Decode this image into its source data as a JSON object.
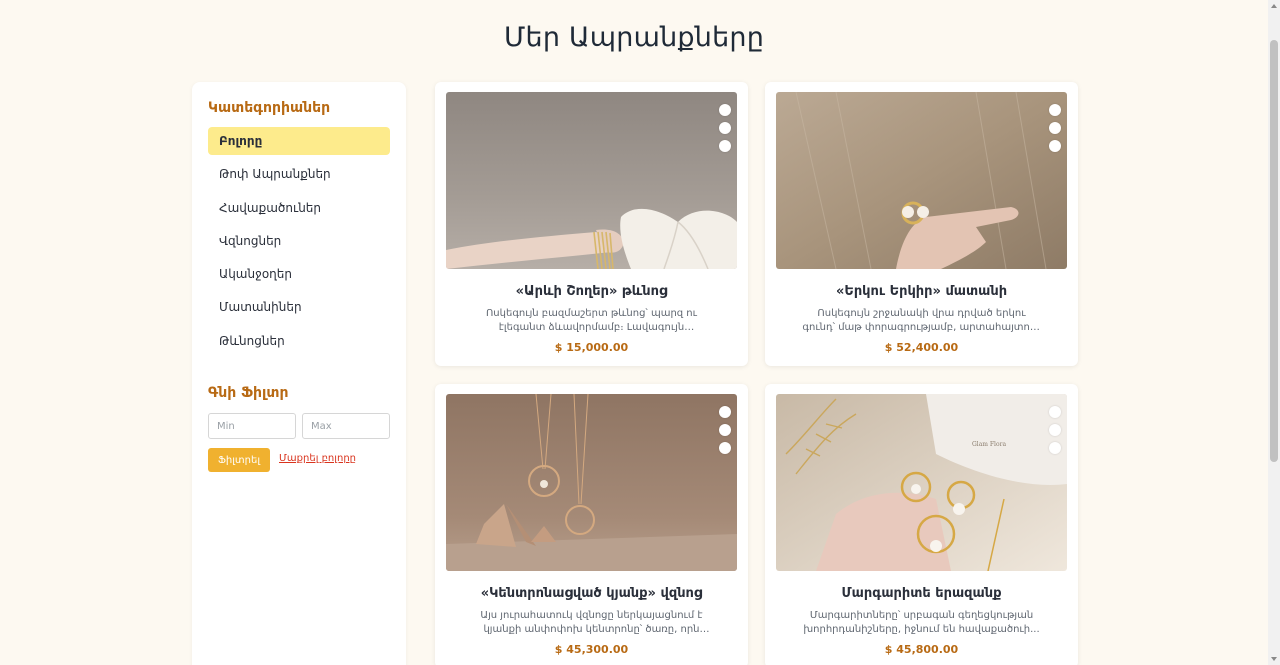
{
  "page": {
    "title": "Մեր Ապրանքները"
  },
  "sidebar": {
    "categories_title": "Կատեգորիաներ",
    "categories": [
      {
        "label": "Բոլորը",
        "active": true
      },
      {
        "label": "Թոփ Ապրանքներ",
        "active": false
      },
      {
        "label": "Հավաքածուներ",
        "active": false
      },
      {
        "label": "Վզնոցներ",
        "active": false
      },
      {
        "label": "Ականջօղեր",
        "active": false
      },
      {
        "label": "Մատանիներ",
        "active": false
      },
      {
        "label": "Թևնոցներ",
        "active": false
      }
    ],
    "price_filter_title": "Գնի Ֆիլտր",
    "min_placeholder": "Min",
    "max_placeholder": "Max",
    "filter_button": "Ֆիլտրել",
    "clear_link": "Մաքրել բոլորը"
  },
  "products": [
    {
      "name": "«Արևի Շողեր» թևնոց",
      "description": "Ոսկեգույն բազմաշերտ թևնոց՝ պարզ ու էլեգանտ ձևավորմամբ։ Լավագույն ընտրությունն է՝ օրվա...",
      "price": "$ 15,000.00"
    },
    {
      "name": "«Երկու Երկիր» մատանի",
      "description": "Ոսկեգույն շրջանակի վրա դրված երկու գունդ՝ մաթ փորագրությամբ, արտահայտում են ներդաշնակություն...",
      "price": "$ 52,400.00"
    },
    {
      "name": "«Կենտրոնացված կյանք» վզնոց",
      "description": "Այս յուրահատուկ վզնոցը ներկայացնում է կյանքի անփոփոխ կենտրոնը՝ ծառը, որն աճում և ծաղկում է...",
      "price": "$ 45,300.00"
    },
    {
      "name": "Մարգարիտե երազանք",
      "description": "Մարգարիտները՝ սրբագան գեղեցկության խորհրդանիշները, իջնում են հավաքածուի...",
      "price": "$ 45,800.00",
      "image_watermark": "Glam Flora"
    }
  ]
}
